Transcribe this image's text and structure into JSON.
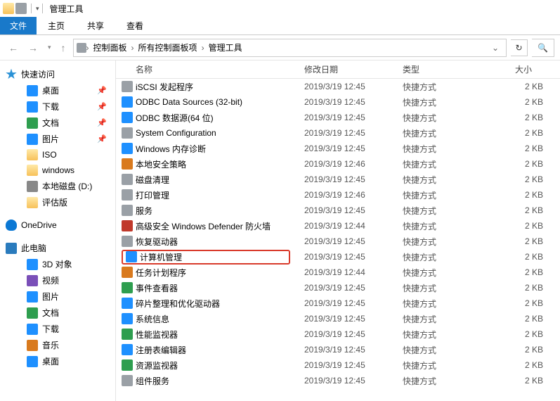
{
  "title": "管理工具",
  "ribbon": {
    "file": "文件",
    "tabs": [
      "主页",
      "共享",
      "查看"
    ]
  },
  "breadcrumbs": [
    "控制面板",
    "所有控制面板项",
    "管理工具"
  ],
  "columns": {
    "name": "名称",
    "date": "修改日期",
    "type": "类型",
    "size": "大小"
  },
  "sidebar": {
    "quick": {
      "label": "快速访问",
      "items": [
        {
          "label": "桌面",
          "icon": "ic-blue",
          "pinned": true
        },
        {
          "label": "下载",
          "icon": "ic-blue",
          "pinned": true
        },
        {
          "label": "文档",
          "icon": "ic-green",
          "pinned": true
        },
        {
          "label": "图片",
          "icon": "ic-blue",
          "pinned": true
        },
        {
          "label": "ISO",
          "icon": "ic-folder",
          "pinned": false
        },
        {
          "label": "windows",
          "icon": "ic-folder",
          "pinned": false
        },
        {
          "label": "本地磁盘 (D:)",
          "icon": "ic-disk",
          "pinned": false
        },
        {
          "label": "评估版",
          "icon": "ic-folder",
          "pinned": false
        }
      ]
    },
    "onedrive": {
      "label": "OneDrive"
    },
    "pc": {
      "label": "此电脑",
      "items": [
        {
          "label": "3D 对象",
          "icon": "ic-blue"
        },
        {
          "label": "视频",
          "icon": "ic-purple"
        },
        {
          "label": "图片",
          "icon": "ic-blue"
        },
        {
          "label": "文档",
          "icon": "ic-green"
        },
        {
          "label": "下载",
          "icon": "ic-blue"
        },
        {
          "label": "音乐",
          "icon": "ic-orange"
        },
        {
          "label": "桌面",
          "icon": "ic-blue"
        }
      ]
    }
  },
  "files": [
    {
      "name": "iSCSI 发起程序",
      "date": "2019/3/19 12:45",
      "type": "快捷方式",
      "size": "2 KB",
      "icon": "ic-grey"
    },
    {
      "name": "ODBC Data Sources (32-bit)",
      "date": "2019/3/19 12:45",
      "type": "快捷方式",
      "size": "2 KB",
      "icon": "ic-blue"
    },
    {
      "name": "ODBC 数据源(64 位)",
      "date": "2019/3/19 12:45",
      "type": "快捷方式",
      "size": "2 KB",
      "icon": "ic-blue"
    },
    {
      "name": "System Configuration",
      "date": "2019/3/19 12:45",
      "type": "快捷方式",
      "size": "2 KB",
      "icon": "ic-grey"
    },
    {
      "name": "Windows 内存诊断",
      "date": "2019/3/19 12:45",
      "type": "快捷方式",
      "size": "2 KB",
      "icon": "ic-blue"
    },
    {
      "name": "本地安全策略",
      "date": "2019/3/19 12:46",
      "type": "快捷方式",
      "size": "2 KB",
      "icon": "ic-orange"
    },
    {
      "name": "磁盘清理",
      "date": "2019/3/19 12:45",
      "type": "快捷方式",
      "size": "2 KB",
      "icon": "ic-grey"
    },
    {
      "name": "打印管理",
      "date": "2019/3/19 12:46",
      "type": "快捷方式",
      "size": "2 KB",
      "icon": "ic-grey"
    },
    {
      "name": "服务",
      "date": "2019/3/19 12:45",
      "type": "快捷方式",
      "size": "2 KB",
      "icon": "ic-grey"
    },
    {
      "name": "高级安全 Windows Defender 防火墙",
      "date": "2019/3/19 12:44",
      "type": "快捷方式",
      "size": "2 KB",
      "icon": "ic-red"
    },
    {
      "name": "恢复驱动器",
      "date": "2019/3/19 12:45",
      "type": "快捷方式",
      "size": "2 KB",
      "icon": "ic-grey"
    },
    {
      "name": "计算机管理",
      "date": "2019/3/19 12:45",
      "type": "快捷方式",
      "size": "2 KB",
      "icon": "ic-blue",
      "highlight": true
    },
    {
      "name": "任务计划程序",
      "date": "2019/3/19 12:44",
      "type": "快捷方式",
      "size": "2 KB",
      "icon": "ic-orange"
    },
    {
      "name": "事件查看器",
      "date": "2019/3/19 12:45",
      "type": "快捷方式",
      "size": "2 KB",
      "icon": "ic-green"
    },
    {
      "name": "碎片整理和优化驱动器",
      "date": "2019/3/19 12:45",
      "type": "快捷方式",
      "size": "2 KB",
      "icon": "ic-blue"
    },
    {
      "name": "系统信息",
      "date": "2019/3/19 12:45",
      "type": "快捷方式",
      "size": "2 KB",
      "icon": "ic-blue"
    },
    {
      "name": "性能监视器",
      "date": "2019/3/19 12:45",
      "type": "快捷方式",
      "size": "2 KB",
      "icon": "ic-green"
    },
    {
      "name": "注册表编辑器",
      "date": "2019/3/19 12:45",
      "type": "快捷方式",
      "size": "2 KB",
      "icon": "ic-blue"
    },
    {
      "name": "资源监视器",
      "date": "2019/3/19 12:45",
      "type": "快捷方式",
      "size": "2 KB",
      "icon": "ic-green"
    },
    {
      "name": "组件服务",
      "date": "2019/3/19 12:45",
      "type": "快捷方式",
      "size": "2 KB",
      "icon": "ic-grey"
    }
  ]
}
